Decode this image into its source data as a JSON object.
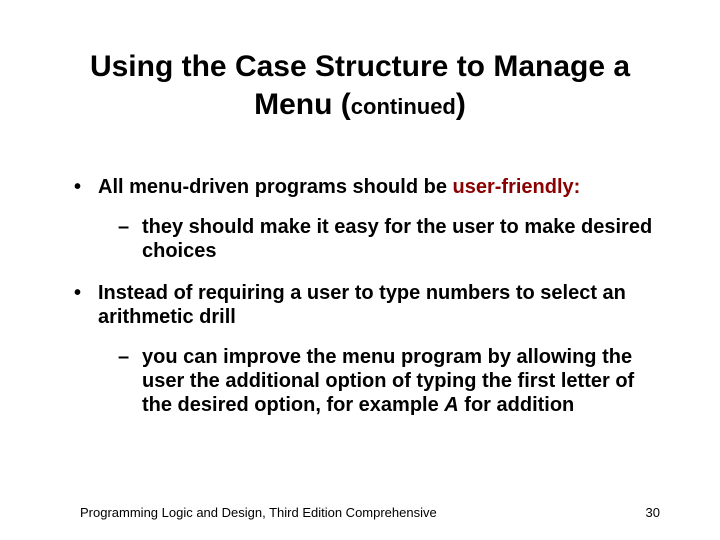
{
  "title": {
    "line1": "Using the Case Structure to Manage a",
    "line2_pre": "Menu (",
    "line2_cont": "continued",
    "line2_post": ")"
  },
  "bullets": [
    {
      "pre": "All menu-driven programs should be ",
      "highlight": "user-friendly:",
      "sub": [
        "they should make it easy for the user to make desired choices"
      ]
    },
    {
      "pre": "Instead of requiring a user to type numbers to select an arithmetic drill",
      "sub": [
        {
          "pre": " you can improve the menu program by allowing the user the additional option of typing the first letter of the desired option, for example ",
          "em": "A",
          "post": " for addition"
        }
      ]
    }
  ],
  "footer": {
    "text": "Programming Logic and Design, Third Edition Comprehensive",
    "page": "30"
  }
}
